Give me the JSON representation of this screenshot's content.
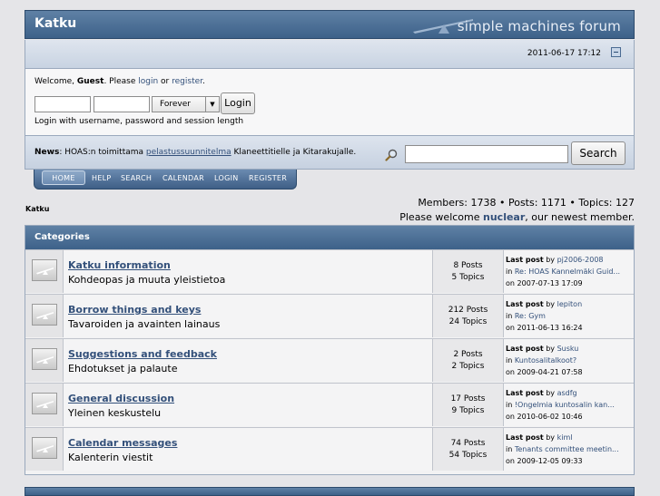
{
  "header": {
    "title": "Katku",
    "brand": "simple machines forum"
  },
  "userbar": {
    "time": "2011-06-17 17:12"
  },
  "login": {
    "welcome_prefix": "Welcome, ",
    "guest": "Guest",
    "please": ". Please ",
    "login_link": "login",
    "or": " or ",
    "register_link": "register",
    "period": ".",
    "duration": "Forever",
    "button": "Login",
    "hint": "Login with username, password and session length"
  },
  "news": {
    "label": "News",
    "text_before": ": HOAS:n toimittama ",
    "link": "pelastussuunnitelma",
    "text_after": " Klaneettitielle ja Kitarakujalle.",
    "search_button": "Search"
  },
  "menu": [
    "HOME",
    "HELP",
    "SEARCH",
    "CALENDAR",
    "LOGIN",
    "REGISTER"
  ],
  "breadcrumb": "Katku",
  "stats": {
    "line1": "Members: 1738  •  Posts: 1171  •  Topics: 127",
    "welcome_prefix": "Please welcome ",
    "newest": "nuclear",
    "welcome_suffix": ", our newest member."
  },
  "categories": {
    "title": "Categories",
    "boards": [
      {
        "name": "Katku information",
        "desc": "Kohdeopas ja muuta yleistietoa",
        "posts": "8 Posts",
        "topics": "5 Topics",
        "last_label": "Last post",
        "by": " by ",
        "user": "pj2006-2008",
        "in": "in ",
        "topic": "Re: HOAS Kannelmäki Guid...",
        "on": "on 2007-07-13 17:09"
      },
      {
        "name": "Borrow things and keys",
        "desc": "Tavaroiden ja avainten lainaus",
        "posts": "212 Posts",
        "topics": "24 Topics",
        "last_label": "Last post",
        "by": " by ",
        "user": "lepiton",
        "in": "in ",
        "topic": "Re: Gym",
        "on": "on 2011-06-13 16:24"
      },
      {
        "name": "Suggestions and feedback",
        "desc": "Ehdotukset ja palaute",
        "posts": "2 Posts",
        "topics": "2 Topics",
        "last_label": "Last post",
        "by": " by ",
        "user": "Susku",
        "in": "in ",
        "topic": "Kuntosalitalkoot?",
        "on": "on 2009-04-21 07:58"
      },
      {
        "name": "General discussion",
        "desc": "Yleinen keskustelu",
        "posts": "17 Posts",
        "topics": "9 Topics",
        "last_label": "Last post",
        "by": " by ",
        "user": "asdfg",
        "in": "in ",
        "topic": "!Ongelmia kuntosalin kan...",
        "on": "on 2010-06-02 10:46"
      },
      {
        "name": "Calendar messages",
        "desc": "Kalenterin viestit",
        "posts": "74 Posts",
        "topics": "54 Topics",
        "last_label": "Last post",
        "by": " by ",
        "user": "kiml",
        "in": "in ",
        "topic": "Tenants committee meetin...",
        "on": "on 2009-12-05 09:33"
      }
    ]
  }
}
